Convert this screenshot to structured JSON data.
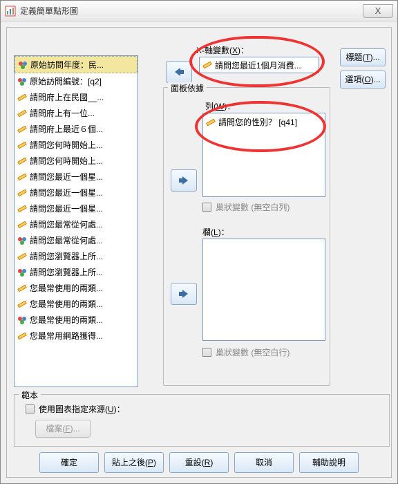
{
  "window": {
    "title": "定義簡單點形圖",
    "close": "X"
  },
  "varlist": [
    {
      "label": "原始訪問年度：民...",
      "icon": "nominal",
      "sel": true
    },
    {
      "label": "原始訪問編號：[q2]",
      "icon": "nominal"
    },
    {
      "label": "請問府上在民國__...",
      "icon": "scale"
    },
    {
      "label": "請問府上有一位...",
      "icon": "scale"
    },
    {
      "label": "請問府上最近６個...",
      "icon": "scale"
    },
    {
      "label": "請問您何時開始上...",
      "icon": "scale"
    },
    {
      "label": "請問您何時開始上...",
      "icon": "scale"
    },
    {
      "label": "請問您最近一個星...",
      "icon": "scale"
    },
    {
      "label": "請問您最近一個星...",
      "icon": "scale"
    },
    {
      "label": "請問您最近一個星...",
      "icon": "scale"
    },
    {
      "label": "請問您最常從何處...",
      "icon": "scale"
    },
    {
      "label": "請問您最常從何處...",
      "icon": "nominal"
    },
    {
      "label": "請問您瀏覽器上所...",
      "icon": "scale"
    },
    {
      "label": "請問您瀏覽器上所...",
      "icon": "nominal"
    },
    {
      "label": "您最常使用的兩類...",
      "icon": "scale"
    },
    {
      "label": "您最常使用的兩類...",
      "icon": "scale"
    },
    {
      "label": "您最常使用的兩類...",
      "icon": "nominal"
    },
    {
      "label": "您最常用網路獲得...",
      "icon": "scale"
    }
  ],
  "xaxis": {
    "label_prefix": "X-軸變數(",
    "label_u": "X",
    "label_suffix": ")：",
    "value": "請問您最近1個月消費..."
  },
  "sidebuttons": {
    "title_prefix": "標題(",
    "title_u": "T",
    "title_suffix": ")...",
    "options_prefix": "選項(",
    "options_u": "O",
    "options_suffix": ")..."
  },
  "panel": {
    "legend": "面板依據",
    "row_label_prefix": "列(",
    "row_label_u": "W",
    "row_label_suffix": ")：",
    "row_value": "請問您的性別？ [q41]",
    "nest_row": "巢狀變數 (無空白列)",
    "col_label_prefix": "欄(",
    "col_label_u": "L",
    "col_label_suffix": ")：",
    "nest_col": "巢狀變數 (無空白行)"
  },
  "template": {
    "legend": "範本",
    "use_prefix": "使用圖表指定來源(",
    "use_u": "U",
    "use_suffix": ")：",
    "file_prefix": "檔案(",
    "file_u": "F",
    "file_suffix": ")..."
  },
  "buttons": {
    "ok": "確定",
    "paste_prefix": "貼上之後(",
    "paste_u": "P",
    "paste_suffix": ")",
    "reset_prefix": "重設(",
    "reset_u": "R",
    "reset_suffix": ")",
    "cancel": "取消",
    "help": "輔助說明"
  }
}
